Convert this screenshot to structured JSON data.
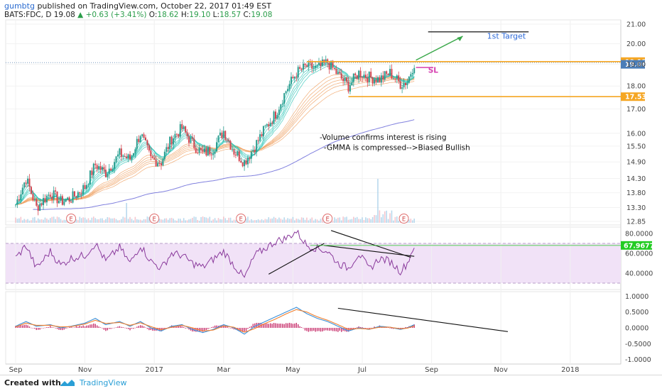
{
  "header": {
    "user": "gumbtg",
    "published_text": "published on TradingView.com, October 22, 2017 01:49 EST",
    "symbol": "BATS:FDC, D",
    "last": "19.08",
    "change": "+0.63 (+3.41%)",
    "o_label": "O:",
    "o_value": "18.62",
    "h_label": "H:",
    "h_value": "19.10",
    "l_label": "L:",
    "l_value": "18.57",
    "c_label": "C:",
    "c_value": "19.08"
  },
  "footer": {
    "created": "Created with",
    "brand": "TradingView"
  },
  "colors": {
    "candle_up": "#2a9d8f",
    "candle_down": "#d64550",
    "gmma_short": "#29c4b6",
    "gmma_long": "#f0a060",
    "ma200": "#6a6ad8",
    "resistance": "#f5a623",
    "rsi": "#8a3a9c",
    "rsi_band": "#f1e2f7",
    "macd": "#3a8fd8",
    "signal": "#f08030",
    "hist": "#c8336e",
    "annotation": "#2f6bd8",
    "sl": "#d63fb0",
    "target_arrow": "#3aa84a",
    "rsi_badge": "#22cc22"
  },
  "chart_data": [
    {
      "panel": "price",
      "type": "candlestick",
      "x_labels": [
        "Sep",
        "Nov",
        "2017",
        "Mar",
        "May",
        "Jul",
        "Sep",
        "Nov",
        "2018"
      ],
      "y_ticks": [
        "21.00",
        "20.00",
        "19.00",
        "18.00",
        "17.00",
        "16.00",
        "15.50",
        "14.90",
        "14.30",
        "13.80",
        "13.30",
        "12.85"
      ],
      "ylim": [
        12.85,
        21.0
      ],
      "y_scale": "log",
      "price_badges": [
        "19.13",
        "19.08",
        "17.53"
      ],
      "levels": {
        "resistance": 19.13,
        "support": 17.53,
        "target": 20.6
      },
      "earnings_marker": "E",
      "earnings_months": [
        1.6,
        4.0,
        6.5,
        9.0,
        11.2
      ],
      "annotations": [
        "1st Target",
        "SL",
        "-Volume confirms interest is rising",
        "-GMMA is compressed-->Biased Bullish"
      ],
      "series": [
        {
          "name": "",
          "kind": "close",
          "month_pos": [
            0,
            0.3,
            0.6,
            1.0,
            1.3,
            1.6,
            2.0,
            2.3,
            2.6,
            3.0,
            3.3,
            3.6,
            3.9,
            4.2,
            4.5,
            4.8,
            5.1,
            5.4,
            5.7,
            6.0,
            6.3,
            6.6,
            6.9,
            7.2,
            7.5,
            7.8,
            8.1,
            8.4,
            8.7,
            9.0,
            9.3,
            9.6,
            9.9,
            10.2,
            10.5,
            10.8,
            11.1,
            11.3,
            11.5
          ],
          "values": [
            13.4,
            14.3,
            13.3,
            13.8,
            13.5,
            13.6,
            14.0,
            14.8,
            14.5,
            15.2,
            15.0,
            16.0,
            15.0,
            14.9,
            15.8,
            16.2,
            15.6,
            15.2,
            15.4,
            16.1,
            15.3,
            14.9,
            15.5,
            16.2,
            16.8,
            17.8,
            18.6,
            18.9,
            18.8,
            19.1,
            18.5,
            18.0,
            18.6,
            18.4,
            18.3,
            18.6,
            18.1,
            18.2,
            19.08
          ]
        }
      ]
    },
    {
      "panel": "rsi",
      "type": "line",
      "y_ticks": [
        "80.0000",
        "60.0000",
        "40.0000"
      ],
      "ylim": [
        25,
        85
      ],
      "current_badge": "67.9677",
      "series": [
        {
          "name": "",
          "month_pos": [
            0,
            0.3,
            0.6,
            1.0,
            1.3,
            1.6,
            2.0,
            2.3,
            2.6,
            3.0,
            3.3,
            3.6,
            3.9,
            4.2,
            4.5,
            4.8,
            5.1,
            5.4,
            5.7,
            6.0,
            6.3,
            6.6,
            6.9,
            7.2,
            7.5,
            7.8,
            8.1,
            8.4,
            8.7,
            9.0,
            9.3,
            9.6,
            9.9,
            10.2,
            10.5,
            10.8,
            11.1,
            11.3,
            11.5
          ],
          "values": [
            55,
            68,
            45,
            62,
            48,
            55,
            58,
            70,
            52,
            66,
            50,
            68,
            52,
            45,
            60,
            58,
            50,
            46,
            54,
            62,
            48,
            35,
            58,
            65,
            72,
            75,
            82,
            68,
            65,
            62,
            50,
            45,
            60,
            44,
            55,
            52,
            42,
            50,
            68
          ]
        }
      ]
    },
    {
      "panel": "macd",
      "type": "line",
      "y_ticks": [
        "1.0000",
        "0.5000",
        "0.0000",
        "-0.5000",
        "-1.0000"
      ],
      "ylim": [
        -1.1,
        1.1
      ],
      "series": [
        {
          "name": "",
          "month_pos": [
            0,
            0.3,
            0.6,
            1.0,
            1.3,
            1.6,
            2.0,
            2.3,
            2.6,
            3.0,
            3.3,
            3.6,
            3.9,
            4.2,
            4.5,
            4.8,
            5.1,
            5.4,
            5.7,
            6.0,
            6.3,
            6.6,
            6.9,
            7.2,
            7.5,
            7.8,
            8.1,
            8.4,
            8.7,
            9.0,
            9.3,
            9.6,
            9.9,
            10.2,
            10.5,
            10.8,
            11.1,
            11.3,
            11.5
          ],
          "values": [
            0.05,
            0.2,
            0.05,
            0.1,
            0.0,
            0.05,
            0.15,
            0.3,
            0.1,
            0.2,
            0.05,
            0.2,
            0.0,
            -0.1,
            0.05,
            0.1,
            -0.05,
            -0.15,
            -0.05,
            0.1,
            0.0,
            -0.2,
            0.05,
            0.2,
            0.35,
            0.5,
            0.65,
            0.45,
            0.3,
            0.2,
            0.05,
            -0.1,
            0.0,
            -0.05,
            0.05,
            0.02,
            -0.05,
            0.0,
            0.1
          ]
        },
        {
          "name": "",
          "month_pos": [
            0,
            0.3,
            0.6,
            1.0,
            1.3,
            1.6,
            2.0,
            2.3,
            2.6,
            3.0,
            3.3,
            3.6,
            3.9,
            4.2,
            4.5,
            4.8,
            5.1,
            5.4,
            5.7,
            6.0,
            6.3,
            6.6,
            6.9,
            7.2,
            7.5,
            7.8,
            8.1,
            8.4,
            8.7,
            9.0,
            9.3,
            9.6,
            9.9,
            10.2,
            10.5,
            10.8,
            11.1,
            11.3,
            11.5
          ],
          "values": [
            0.03,
            0.15,
            0.08,
            0.08,
            0.03,
            0.04,
            0.12,
            0.24,
            0.14,
            0.17,
            0.08,
            0.16,
            0.04,
            -0.06,
            0.02,
            0.08,
            0.0,
            -0.1,
            -0.07,
            0.06,
            0.02,
            -0.14,
            -0.02,
            0.14,
            0.28,
            0.44,
            0.58,
            0.5,
            0.35,
            0.24,
            0.1,
            -0.05,
            -0.02,
            -0.04,
            0.02,
            0.02,
            -0.03,
            -0.01,
            0.06
          ]
        }
      ]
    }
  ]
}
